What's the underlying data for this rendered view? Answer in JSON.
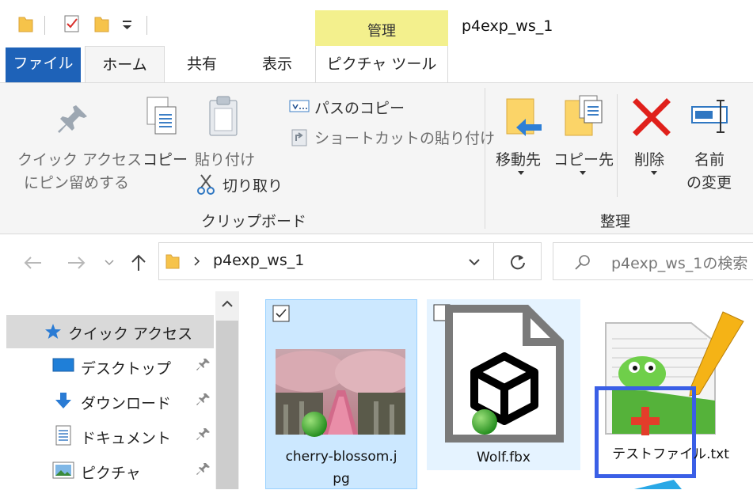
{
  "title": "p4exp_ws_1",
  "context_tab_group": "管理",
  "tabs": {
    "file": "ファイル",
    "home": "ホーム",
    "share": "共有",
    "view": "表示",
    "picture_tools": "ピクチャ ツール"
  },
  "ribbon": {
    "clipboard": {
      "group_label": "クリップボード",
      "pin_line1": "クイック アクセス",
      "pin_line2": "にピン留めする",
      "copy": "コピー",
      "paste": "貼り付け",
      "cut": "切り取り",
      "copy_path": "パスのコピー",
      "paste_shortcut": "ショートカットの貼り付け"
    },
    "organize": {
      "group_label": "整理",
      "move_to": "移動先",
      "copy_to": "コピー先",
      "delete": "削除",
      "rename_line1": "名前",
      "rename_line2": "の変更"
    }
  },
  "address": {
    "path": "p4exp_ws_1",
    "search_placeholder": "p4exp_ws_1の検索"
  },
  "nav": {
    "quick_access": "クイック アクセス",
    "items": [
      {
        "label": "デスクトップ",
        "icon": "desktop-icon"
      },
      {
        "label": "ダウンロード",
        "icon": "download-icon"
      },
      {
        "label": "ドキュメント",
        "icon": "document-icon"
      },
      {
        "label": "ピクチャ",
        "icon": "pictures-icon"
      }
    ]
  },
  "files": [
    {
      "name_line1": "cherry-blossom.j",
      "name_line2": "pg",
      "selected": true,
      "checked": true
    },
    {
      "name": "Wolf.fbx",
      "selected": false,
      "checked": false
    },
    {
      "name": "テストファイル.txt",
      "highlighted": true
    }
  ],
  "colors": {
    "accent": "#1e62b8",
    "context_tab": "#f3f08d",
    "selection": "#cce8ff",
    "highlight_border": "#3a5fe6",
    "delete_red": "#e0201b"
  }
}
